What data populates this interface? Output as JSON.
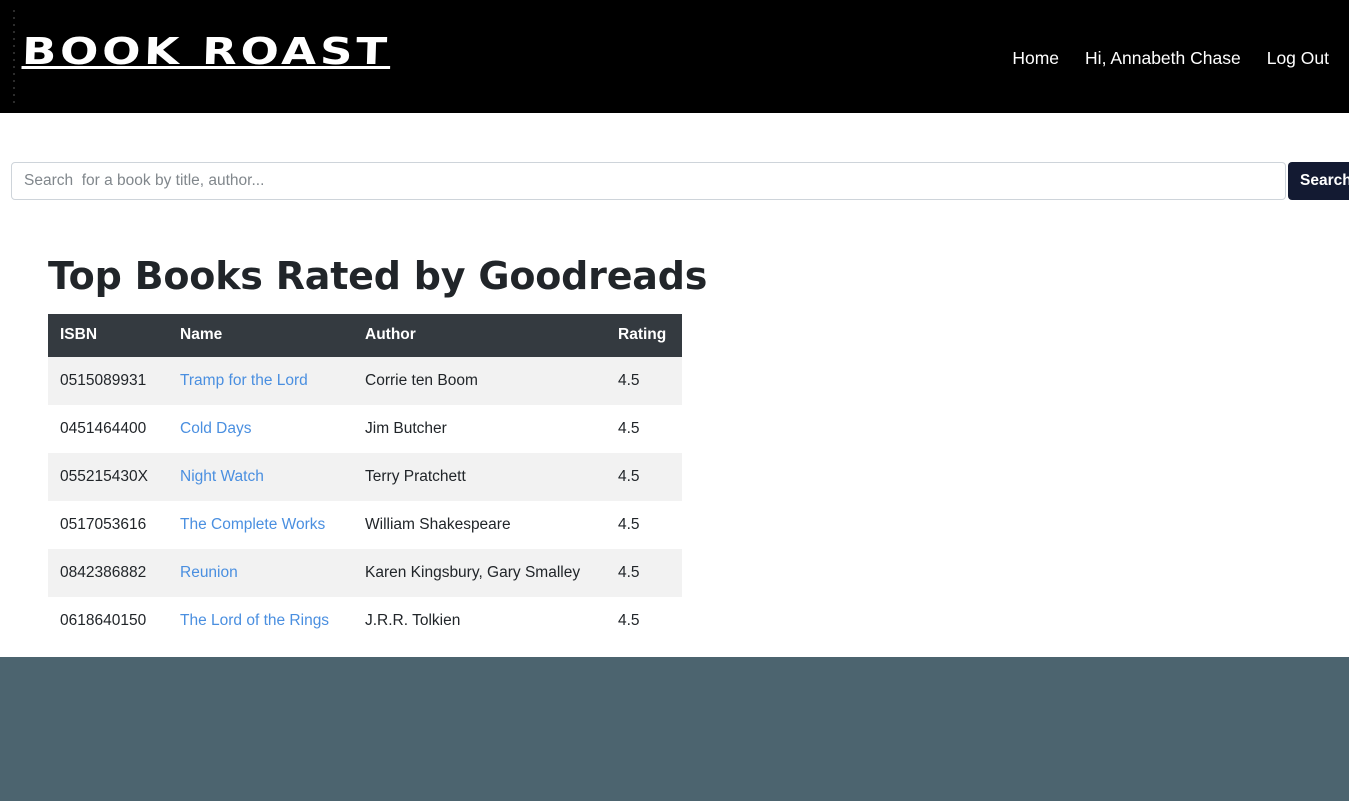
{
  "navbar": {
    "brand": "BOOK ROAST",
    "links": [
      {
        "label": "Home",
        "name": "nav-link-home"
      },
      {
        "label": "Hi, Annabeth Chase",
        "name": "nav-link-greeting"
      },
      {
        "label": "Log Out",
        "name": "nav-link-logout"
      }
    ]
  },
  "search": {
    "value": "",
    "placeholder": "Search  for a book by title, author...",
    "button_label": "Search"
  },
  "main": {
    "title": "Top Books Rated by Goodreads",
    "table": {
      "columns": [
        "ISBN",
        "Name",
        "Author",
        "Rating"
      ],
      "rows": [
        {
          "isbn": "0515089931",
          "name": "Tramp for the Lord",
          "author": "Corrie ten Boom",
          "rating": "4.5"
        },
        {
          "isbn": "0451464400",
          "name": "Cold Days",
          "author": "Jim Butcher",
          "rating": "4.5"
        },
        {
          "isbn": "055215430X",
          "name": "Night Watch",
          "author": "Terry Pratchett",
          "rating": "4.5"
        },
        {
          "isbn": "0517053616",
          "name": "The Complete Works",
          "author": "William Shakespeare",
          "rating": "4.5"
        },
        {
          "isbn": "0842386882",
          "name": "Reunion",
          "author": "Karen Kingsbury, Gary Smalley",
          "rating": "4.5"
        },
        {
          "isbn": "0618640150",
          "name": "The Lord of the Rings",
          "author": "J.R.R. Tolkien",
          "rating": "4.5"
        }
      ]
    }
  },
  "colors": {
    "navbar_bg": "#000000",
    "search_button_bg": "#131a32",
    "table_header_bg": "#343a40",
    "table_stripe_bg": "#f2f2f2",
    "link_blue": "#4a8fe0",
    "footer_bg": "#4c646f"
  }
}
